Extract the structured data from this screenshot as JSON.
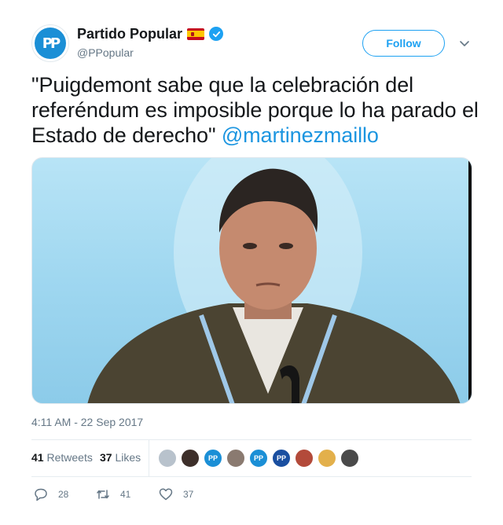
{
  "author": {
    "display_name": "Partido Popular",
    "handle": "@PPopular",
    "avatar_text": "PP",
    "verified": true,
    "flag": "spain-flag-icon"
  },
  "follow_label": "Follow",
  "tweet": {
    "text": "\"Puigdemont sabe que la celebración del referéndum es imposible porque lo ha parado el Estado de derecho\" ",
    "mention": "@martinezmaillo"
  },
  "timestamp": "4:11 AM - 22 Sep 2017",
  "stats": {
    "retweets_count": "41",
    "retweets_label": "Retweets",
    "likes_count": "37",
    "likes_label": "Likes"
  },
  "actions": {
    "replies": "28",
    "retweets": "41",
    "likes": "37"
  },
  "colors": {
    "accent": "#1da1f2",
    "mention": "#1b95e0",
    "muted": "#657786"
  }
}
